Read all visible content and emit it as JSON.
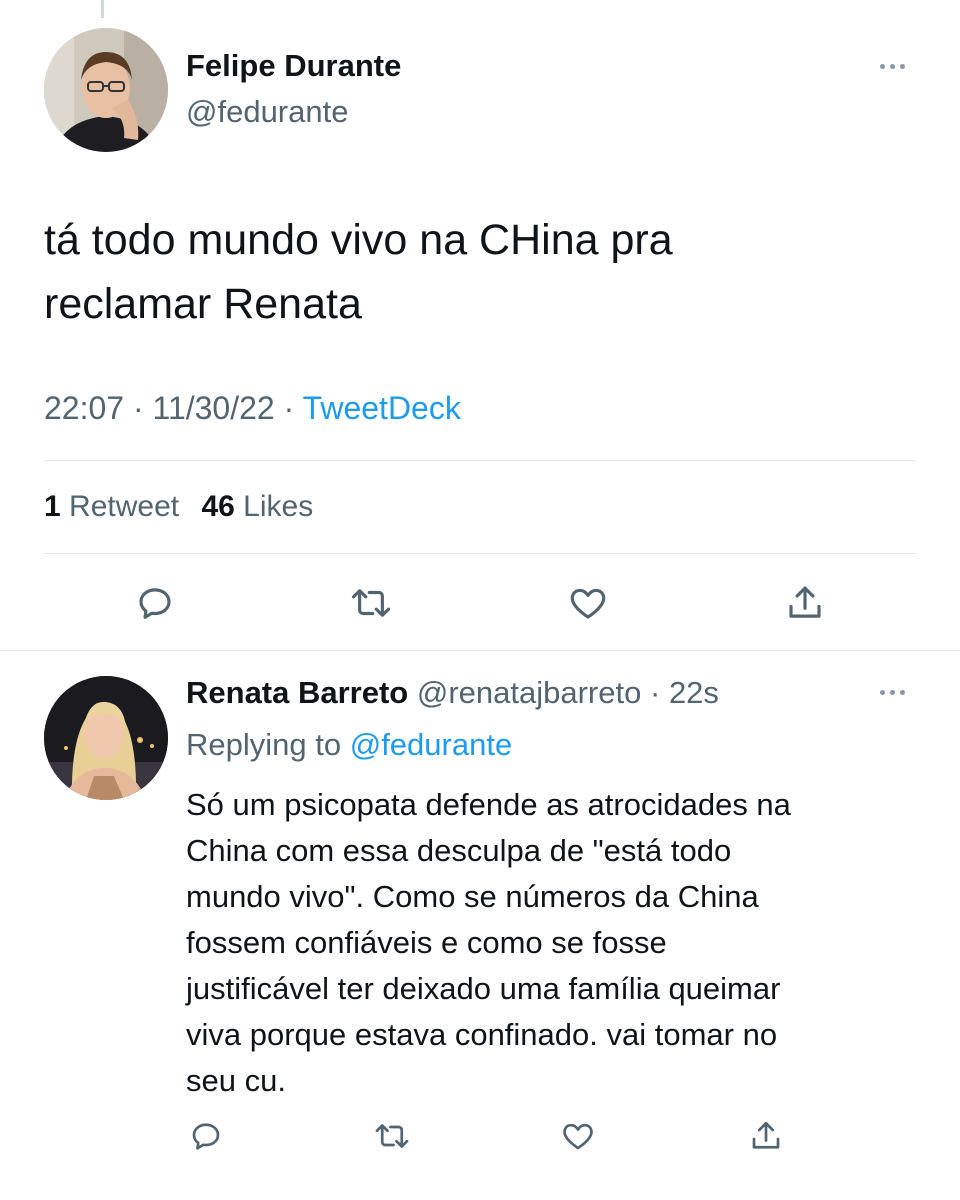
{
  "main_tweet": {
    "author_name": "Felipe Durante",
    "author_handle": "@fedurante",
    "text_line1": "tá todo mundo vivo na CHina pra",
    "text_line2": "reclamar Renata",
    "time": "22:07",
    "date": "11/30/22",
    "separator": "·",
    "source": "TweetDeck",
    "retweet_count": "1",
    "retweet_label": "Retweet",
    "like_count": "46",
    "like_label": "Likes"
  },
  "reply": {
    "author_name": "Renata Barreto",
    "author_handle": "@renatajbarreto",
    "separator": "·",
    "age": "22s",
    "replying_prefix": "Replying to",
    "replying_to": "@fedurante",
    "lines": [
      "Só um psicopata defende as atrocidades na",
      "China com essa desculpa de \"está todo",
      "mundo vivo\". Como se números da China",
      "fossem confiáveis e como se fosse",
      "justificável ter deixado uma família queimar",
      "viva porque estava confinado. vai tomar no",
      "seu cu."
    ]
  },
  "icons": {
    "reply": "reply-icon",
    "retweet": "retweet-icon",
    "like": "heart-icon",
    "share": "share-icon",
    "more": "more-icon"
  },
  "colors": {
    "accent": "#1d9bf0",
    "muted": "#536471",
    "text": "#0f1419"
  }
}
